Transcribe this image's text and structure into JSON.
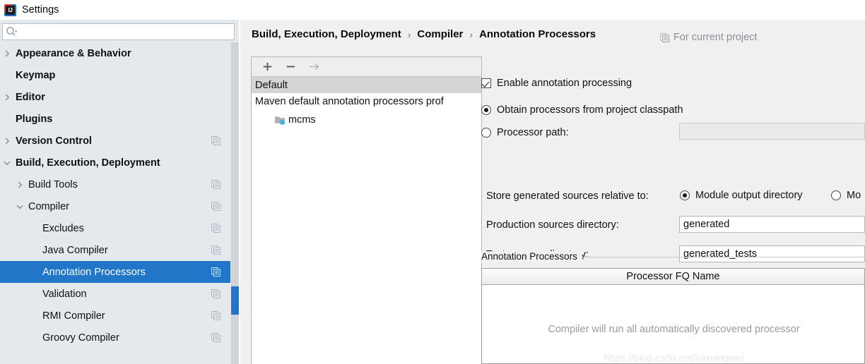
{
  "window": {
    "title": "Settings",
    "app_icon": "intellij-idea-icon",
    "icon_text": "IJ"
  },
  "search": {
    "value": "",
    "placeholder": "",
    "icon": "search-icon"
  },
  "sidebar": {
    "items": [
      {
        "label": "Appearance & Behavior",
        "level": 0,
        "twisty": "collapsed",
        "selected": false,
        "copy_icon": false
      },
      {
        "label": "Keymap",
        "level": 0,
        "twisty": "none",
        "selected": false,
        "copy_icon": false
      },
      {
        "label": "Editor",
        "level": 0,
        "twisty": "collapsed",
        "selected": false,
        "copy_icon": false
      },
      {
        "label": "Plugins",
        "level": 0,
        "twisty": "none",
        "selected": false,
        "copy_icon": false
      },
      {
        "label": "Version Control",
        "level": 0,
        "twisty": "collapsed",
        "selected": false,
        "copy_icon": true
      },
      {
        "label": "Build, Execution, Deployment",
        "level": 0,
        "twisty": "expanded",
        "selected": false,
        "copy_icon": false
      },
      {
        "label": "Build Tools",
        "level": 1,
        "twisty": "collapsed",
        "selected": false,
        "copy_icon": true
      },
      {
        "label": "Compiler",
        "level": 1,
        "twisty": "expanded",
        "selected": false,
        "copy_icon": true
      },
      {
        "label": "Excludes",
        "level": 2,
        "twisty": "none",
        "selected": false,
        "copy_icon": true
      },
      {
        "label": "Java Compiler",
        "level": 2,
        "twisty": "none",
        "selected": false,
        "copy_icon": true
      },
      {
        "label": "Annotation Processors",
        "level": 2,
        "twisty": "none",
        "selected": true,
        "copy_icon": true
      },
      {
        "label": "Validation",
        "level": 2,
        "twisty": "none",
        "selected": false,
        "copy_icon": true
      },
      {
        "label": "RMI Compiler",
        "level": 2,
        "twisty": "none",
        "selected": false,
        "copy_icon": true
      },
      {
        "label": "Groovy Compiler",
        "level": 2,
        "twisty": "none",
        "selected": false,
        "copy_icon": true
      }
    ],
    "selection_color": "#2176c7",
    "background_color": "#e4e9ee",
    "scrollbar": {
      "thumb_color": "#2176c7",
      "track_color": "#ced4da"
    }
  },
  "header": {
    "breadcrumb": [
      "Build, Execution, Deployment",
      "Compiler",
      "Annotation Processors"
    ],
    "separator": "›",
    "for_current_project": {
      "label": "For current project",
      "icon": "copy-icon"
    }
  },
  "profiles_panel": {
    "toolbar": [
      {
        "name": "add-profile-button",
        "glyph": "plus",
        "enabled": true
      },
      {
        "name": "remove-profile-button",
        "glyph": "minus",
        "enabled": true
      },
      {
        "name": "move-to-profile-button",
        "glyph": "arrow-right",
        "enabled": false
      }
    ],
    "rows": [
      {
        "label": "Default",
        "selected": true
      },
      {
        "label": "Maven default annotation processors prof",
        "selected": false
      }
    ],
    "children": [
      {
        "label": "mcms",
        "icon": "module-folder-icon"
      }
    ]
  },
  "options": {
    "enable_annotation_processing": {
      "label": "Enable annotation processing",
      "checked": true
    },
    "processor_source": {
      "classpath": {
        "label": "Obtain processors from project classpath",
        "selected": true
      },
      "path": {
        "label": "Processor path:",
        "selected": false,
        "value": "",
        "enabled": false
      }
    },
    "store_relative": {
      "label": "Store generated sources relative to:",
      "choices": [
        {
          "label": "Module output directory",
          "selected": true
        },
        {
          "label": "Mo",
          "selected": false
        }
      ]
    },
    "production_sources": {
      "label": "Production sources directory:",
      "value": "generated"
    },
    "test_sources": {
      "label": "Test sources directory:",
      "value": "generated_tests"
    }
  },
  "processors_group": {
    "title": "Annotation Processors",
    "column_header": "Processor FQ Name",
    "empty_message": "Compiler will run all automatically discovered processor",
    "rows": []
  },
  "watermark": {
    "text": "https://blog.csdn.net/laixiangwei"
  }
}
